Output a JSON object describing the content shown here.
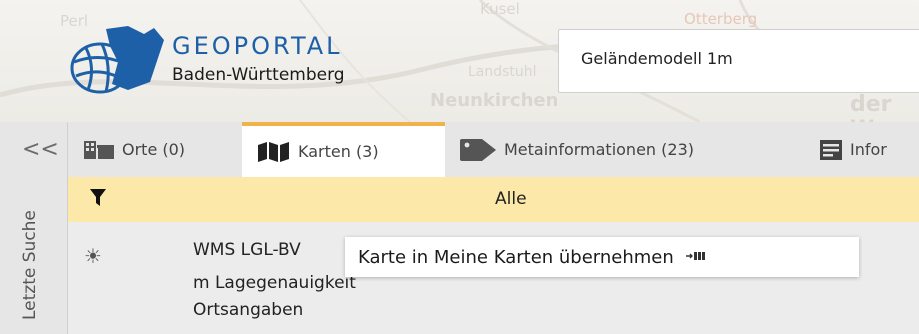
{
  "header": {
    "brand_title": "GEOPORTAL",
    "brand_subtitle": "Baden-Württemberg",
    "search": {
      "value": "Geländemodell 1m"
    },
    "map_labels": [
      "Perl",
      "Kusel",
      "Otterberg",
      "Landstuhl",
      "Neunkirchen",
      "der W"
    ]
  },
  "sidebar": {
    "collapse_glyph": "<<",
    "vertical_label": "Letzte Suche"
  },
  "tabs": [
    {
      "label": "Orte (0)",
      "icon": "buildings-icon"
    },
    {
      "label": "Karten (3)",
      "icon": "map-icon"
    },
    {
      "label": "Metainformationen (23)",
      "icon": "tag-icon"
    },
    {
      "label": "Infor",
      "icon": "document-icon"
    }
  ],
  "filter": {
    "label": "Alle"
  },
  "results": {
    "lines": [
      "WMS LGL-BV",
      "m Lagegenauigkeit",
      "Ortsangaben"
    ],
    "icon": "sun-icon"
  },
  "tooltip": {
    "text": "Karte in Meine Karten übernehmen"
  },
  "colors": {
    "accent": "#f0b24a",
    "filter_bg": "#fce8a8",
    "brand_blue": "#1e60a8"
  }
}
